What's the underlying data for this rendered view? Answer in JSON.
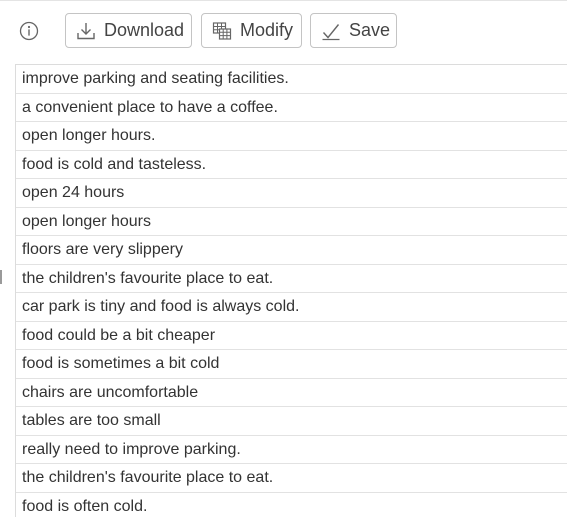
{
  "toolbar": {
    "info_icon": "info-circle-icon",
    "download": {
      "label": "Download",
      "icon": "download-icon"
    },
    "modify": {
      "label": "Modify",
      "icon": "table-edit-icon"
    },
    "save": {
      "label": "Save",
      "icon": "checkmark-icon"
    }
  },
  "responses": [
    "improve parking and seating facilities.",
    "a convenient place to have a coffee.",
    "open longer hours.",
    "food is cold and tasteless.",
    "open 24 hours",
    "open longer hours",
    "floors are very slippery",
    "the children's favourite place to eat.",
    "car park is tiny and food is always cold.",
    "food could be a bit cheaper",
    "food is sometimes a bit cold",
    "chairs are uncomfortable",
    "tables are too small",
    "really need to improve parking.",
    "the children's favourite place to eat.",
    "food is often cold."
  ]
}
